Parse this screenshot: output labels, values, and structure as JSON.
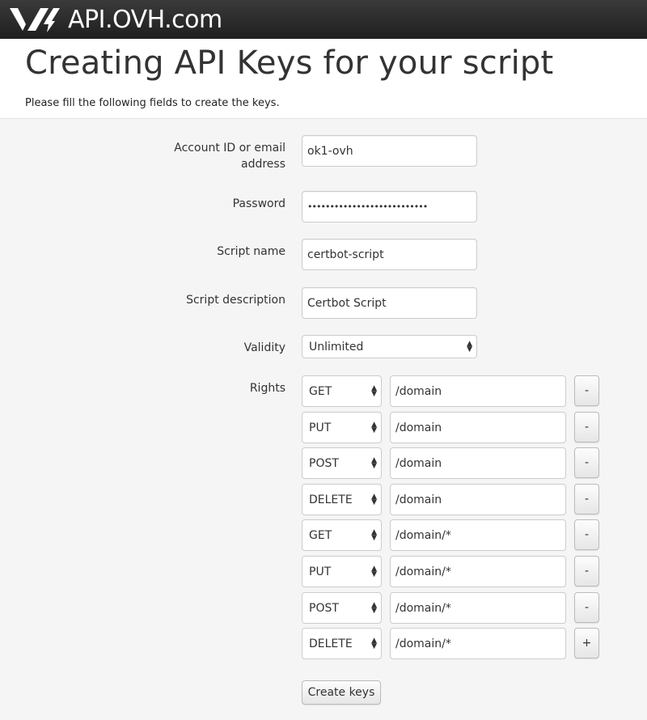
{
  "header": {
    "brand": "API.OVH.com",
    "logo_icon": "ovh-logo-icon"
  },
  "hero": {
    "title": "Creating API Keys for your script",
    "subtitle": "Please fill the following fields to create the keys."
  },
  "form": {
    "account": {
      "label": "Account ID or email address",
      "value": "ok1-ovh"
    },
    "password": {
      "label": "Password",
      "value": "•••••••••••••••••••••••••••"
    },
    "script_name": {
      "label": "Script name",
      "value": "certbot-script"
    },
    "script_description": {
      "label": "Script description",
      "value": "Certbot Script"
    },
    "validity": {
      "label": "Validity",
      "value": "Unlimited"
    },
    "rights": {
      "label": "Rights",
      "rows": [
        {
          "method": "GET",
          "path": "/domain",
          "action": "-"
        },
        {
          "method": "PUT",
          "path": "/domain",
          "action": "-"
        },
        {
          "method": "POST",
          "path": "/domain",
          "action": "-"
        },
        {
          "method": "DELETE",
          "path": "/domain",
          "action": "-"
        },
        {
          "method": "GET",
          "path": "/domain/*",
          "action": "-"
        },
        {
          "method": "PUT",
          "path": "/domain/*",
          "action": "-"
        },
        {
          "method": "POST",
          "path": "/domain/*",
          "action": "-"
        },
        {
          "method": "DELETE",
          "path": "/domain/*",
          "action": "+"
        }
      ]
    },
    "submit_label": "Create keys"
  }
}
